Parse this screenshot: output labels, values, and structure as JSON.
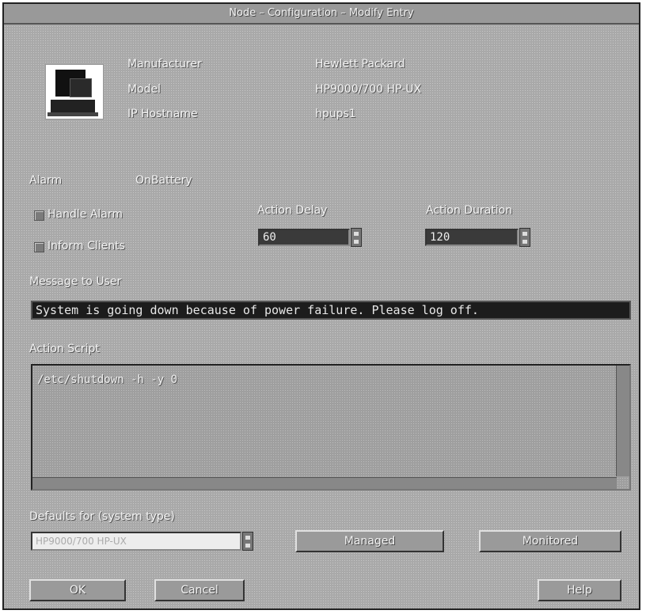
{
  "window": {
    "title": "Node – Configuration – Modify Entry"
  },
  "node_info": {
    "manufacturer_label": "Manufacturer",
    "manufacturer_value": "Hewlett Packard",
    "model_label": "Model",
    "model_value": "HP9000/700 HP-UX",
    "ip_label": "IP Hostname",
    "ip_value": "hpups1",
    "icon": "computer-icon"
  },
  "alarm": {
    "label": "Alarm",
    "value": "OnBattery"
  },
  "options": {
    "handle_alarm": "Handle Alarm",
    "inform_clients": "Inform Clients"
  },
  "action_delay": {
    "label": "Action Delay",
    "value": "60"
  },
  "action_duration": {
    "label": "Action Duration",
    "value": "120"
  },
  "message": {
    "label": "Message to User",
    "value": "System is going down because of power failure. Please log off."
  },
  "script": {
    "label": "Action Script",
    "value": "/etc/shutdown -h -y 0"
  },
  "defaults": {
    "label": "Defaults for (system type)",
    "value": "HP9000/700 HP-UX",
    "managed_button": "Managed",
    "monitored_button": "Monitored"
  },
  "buttons": {
    "ok": "OK",
    "cancel": "Cancel",
    "help": "Help"
  }
}
